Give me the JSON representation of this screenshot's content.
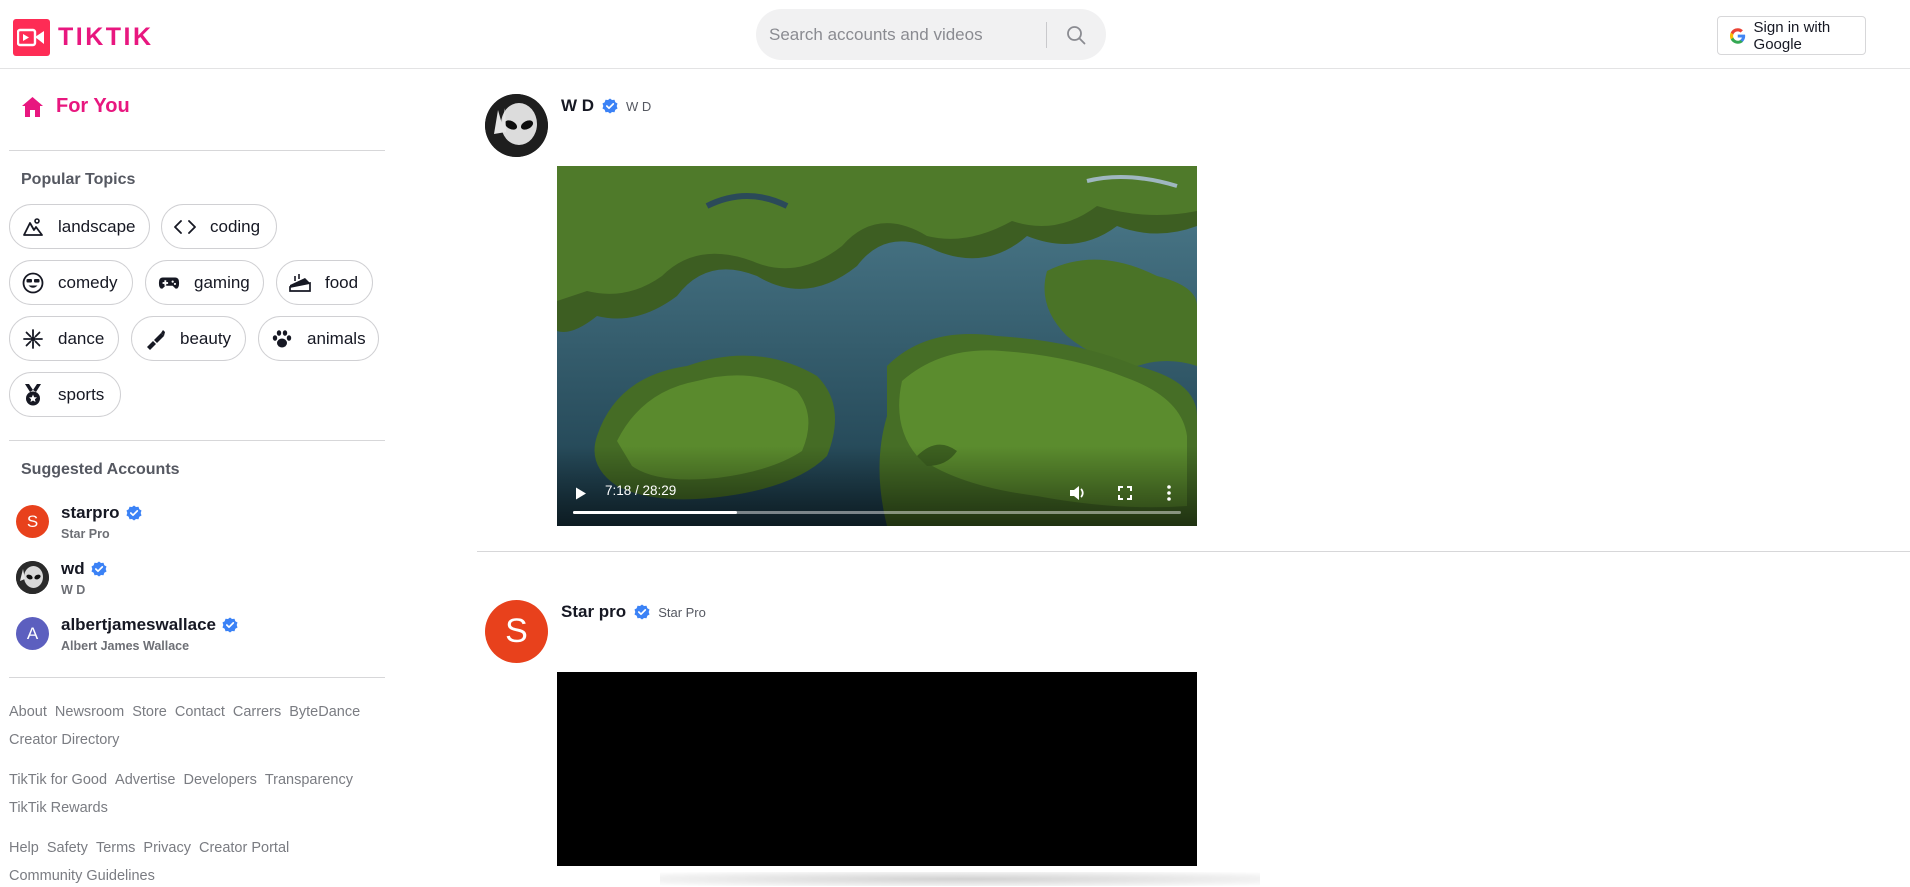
{
  "header": {
    "logo_text": "TIKTIK",
    "search_placeholder": "Search accounts and videos",
    "signin_label": "Sign in with Google"
  },
  "sidebar": {
    "for_you_label": "For You",
    "popular_topics_title": "Popular Topics",
    "topics": [
      {
        "label": "landscape",
        "icon": "landscape-icon"
      },
      {
        "label": "coding",
        "icon": "code-icon"
      },
      {
        "label": "comedy",
        "icon": "laugh-icon"
      },
      {
        "label": "gaming",
        "icon": "gamepad-icon"
      },
      {
        "label": "food",
        "icon": "cake-icon"
      },
      {
        "label": "dance",
        "icon": "dance-icon"
      },
      {
        "label": "beauty",
        "icon": "makeup-icon"
      },
      {
        "label": "animals",
        "icon": "paw-icon"
      },
      {
        "label": "sports",
        "icon": "medal-icon"
      }
    ],
    "suggested_title": "Suggested Accounts",
    "accounts": [
      {
        "username": "starpro",
        "name": "Star Pro",
        "initial": "S",
        "color": "#e8411c"
      },
      {
        "username": "wd",
        "name": "W D",
        "initial": "",
        "color": "#222222"
      },
      {
        "username": "albertjameswallace",
        "name": "Albert James Wallace",
        "initial": "A",
        "color": "#5c5fbf"
      }
    ],
    "footer_groups": [
      [
        "About",
        "Newsroom",
        "Store",
        "Contact",
        "Carrers",
        "ByteDance",
        "Creator Directory"
      ],
      [
        "TikTik for Good",
        "Advertise",
        "Developers",
        "Transparency",
        "TikTik Rewards"
      ],
      [
        "Help",
        "Safety",
        "Terms",
        "Privacy",
        "Creator Portal",
        "Community Guidelines"
      ]
    ]
  },
  "feed": {
    "posts": [
      {
        "display_name": "W D",
        "username": "W D",
        "time": "7:18 / 28:29",
        "progress": 0.27
      },
      {
        "display_name": "Star pro",
        "username": "Star Pro",
        "initial": "S"
      }
    ]
  },
  "colors": {
    "brand": "#e8177f",
    "verified": "#3b82f6",
    "starpro_avatar": "#e8411c"
  }
}
